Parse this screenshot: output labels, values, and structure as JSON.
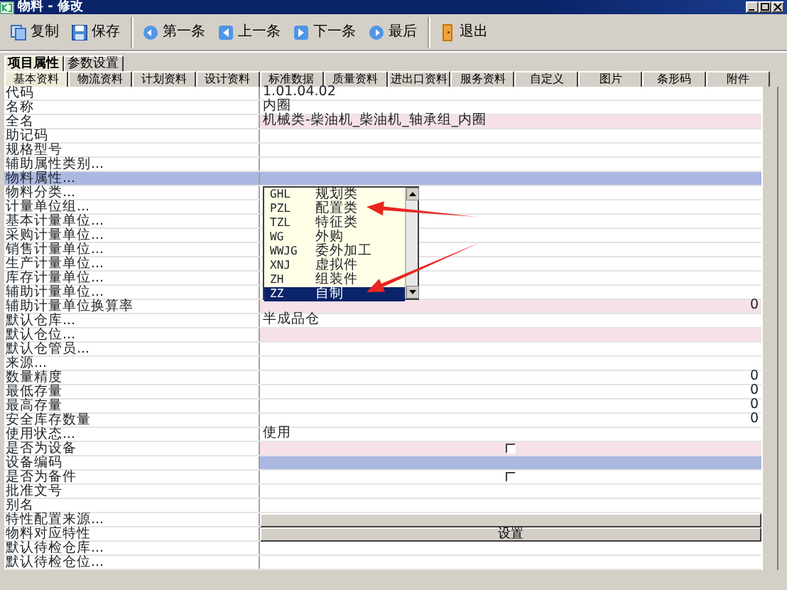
{
  "window": {
    "title": "物料 - 修改"
  },
  "toolbar": [
    [
      "复制",
      "保存"
    ],
    [
      "第一条",
      "上一条",
      "下一条",
      "最后"
    ],
    [
      "退出"
    ]
  ],
  "tabs": [
    {
      "label": "项目属性",
      "selected": true
    },
    {
      "label": "参数设置",
      "selected": false
    }
  ],
  "subtabs": [
    {
      "label": "基本资料",
      "selected": true
    },
    {
      "label": "物流资料",
      "selected": false
    },
    {
      "label": "计划资料",
      "selected": false
    },
    {
      "label": "设计资料",
      "selected": false
    },
    {
      "label": "标准数据",
      "selected": false
    },
    {
      "label": "质量资料",
      "selected": false
    },
    {
      "label": "进出口资料",
      "selected": false
    },
    {
      "label": "服务资料",
      "selected": false
    },
    {
      "label": "自定义",
      "selected": false
    },
    {
      "label": "图片",
      "selected": false
    },
    {
      "label": "条形码",
      "selected": false
    },
    {
      "label": "附件",
      "selected": false
    }
  ],
  "rows": [
    {
      "label": "代码",
      "kind": "text",
      "value": "1.01.04.02",
      "selected": false
    },
    {
      "label": "名称",
      "kind": "text",
      "value": "内圈",
      "selected": false
    },
    {
      "label": "全名",
      "kind": "text",
      "value": "机械类-柴油机_柴油机_轴承组_内圈",
      "color": "#f6e1e6",
      "selected": false
    },
    {
      "label": "助记码",
      "kind": "text",
      "selected": false
    },
    {
      "label": "规格型号",
      "kind": "text",
      "selected": false
    },
    {
      "label": "辅助属性类别...",
      "kind": "text",
      "selected": false
    },
    {
      "label": "物料属性...",
      "kind": "text",
      "selected": true
    },
    {
      "label": "物料分类...",
      "kind": "text",
      "selected": false
    },
    {
      "label": "计量单位组...",
      "kind": "text",
      "selected": false
    },
    {
      "label": "基本计量单位...",
      "kind": "text",
      "selected": false
    },
    {
      "label": "采购计量单位...",
      "kind": "text",
      "selected": false
    },
    {
      "label": "销售计量单位...",
      "kind": "text",
      "selected": false
    },
    {
      "label": "生产计量单位...",
      "kind": "text",
      "selected": false
    },
    {
      "label": "库存计量单位...",
      "kind": "text",
      "selected": false
    },
    {
      "label": "辅助计量单位...",
      "kind": "text",
      "selected": false
    },
    {
      "label": "辅助计量单位换算率",
      "kind": "number",
      "value": "0",
      "color": "#f6e1e6",
      "selected": false
    },
    {
      "label": "默认仓库...",
      "kind": "text",
      "value": "半成品仓",
      "selected": false
    },
    {
      "label": "默认仓位...",
      "kind": "text",
      "color": "#f6e1e6",
      "selected": false
    },
    {
      "label": "默认仓管员...",
      "kind": "text",
      "selected": false
    },
    {
      "label": "来源...",
      "kind": "text",
      "selected": false
    },
    {
      "label": "数量精度",
      "kind": "number",
      "value": "0",
      "selected": false
    },
    {
      "label": "最低存量",
      "kind": "number",
      "value": "0",
      "selected": false
    },
    {
      "label": "最高存量",
      "kind": "number",
      "value": "0",
      "selected": false
    },
    {
      "label": "安全库存数量",
      "kind": "number",
      "value": "0",
      "selected": false
    },
    {
      "label": "使用状态...",
      "kind": "text",
      "value": "使用",
      "selected": false
    },
    {
      "label": "是否为设备",
      "kind": "check",
      "checked": false,
      "color": "#f6e1e6",
      "selected": false
    },
    {
      "label": "设备编码",
      "kind": "text",
      "color": "#aab8e2",
      "selected": false
    },
    {
      "label": "是否为备件",
      "kind": "check",
      "checked": false,
      "selected": false
    },
    {
      "label": "批准文号",
      "kind": "text",
      "selected": false
    },
    {
      "label": "别名",
      "kind": "text",
      "selected": false
    },
    {
      "label": "特性配置来源...",
      "kind": "button",
      "selected": false
    },
    {
      "label": "物料对应特性",
      "kind": "button",
      "value": "设置",
      "selected": false
    },
    {
      "label": "默认待检仓库...",
      "kind": "text",
      "selected": false
    },
    {
      "label": "默认待检仓位...",
      "kind": "text",
      "selected": false
    }
  ],
  "dropdown": {
    "items": [
      {
        "code": "GHL",
        "name": "规划类",
        "selected": false
      },
      {
        "code": "PZL",
        "name": "配置类",
        "selected": false
      },
      {
        "code": "TZL",
        "name": "特征类",
        "selected": false
      },
      {
        "code": "WG",
        "name": "外购",
        "selected": false
      },
      {
        "code": "WWJG",
        "name": "委外加工",
        "selected": false
      },
      {
        "code": "XNJ",
        "name": "虚拟件",
        "selected": false
      },
      {
        "code": "ZH",
        "name": "组装件",
        "selected": false
      },
      {
        "code": "ZZ",
        "name": "自制",
        "selected": true
      }
    ]
  }
}
